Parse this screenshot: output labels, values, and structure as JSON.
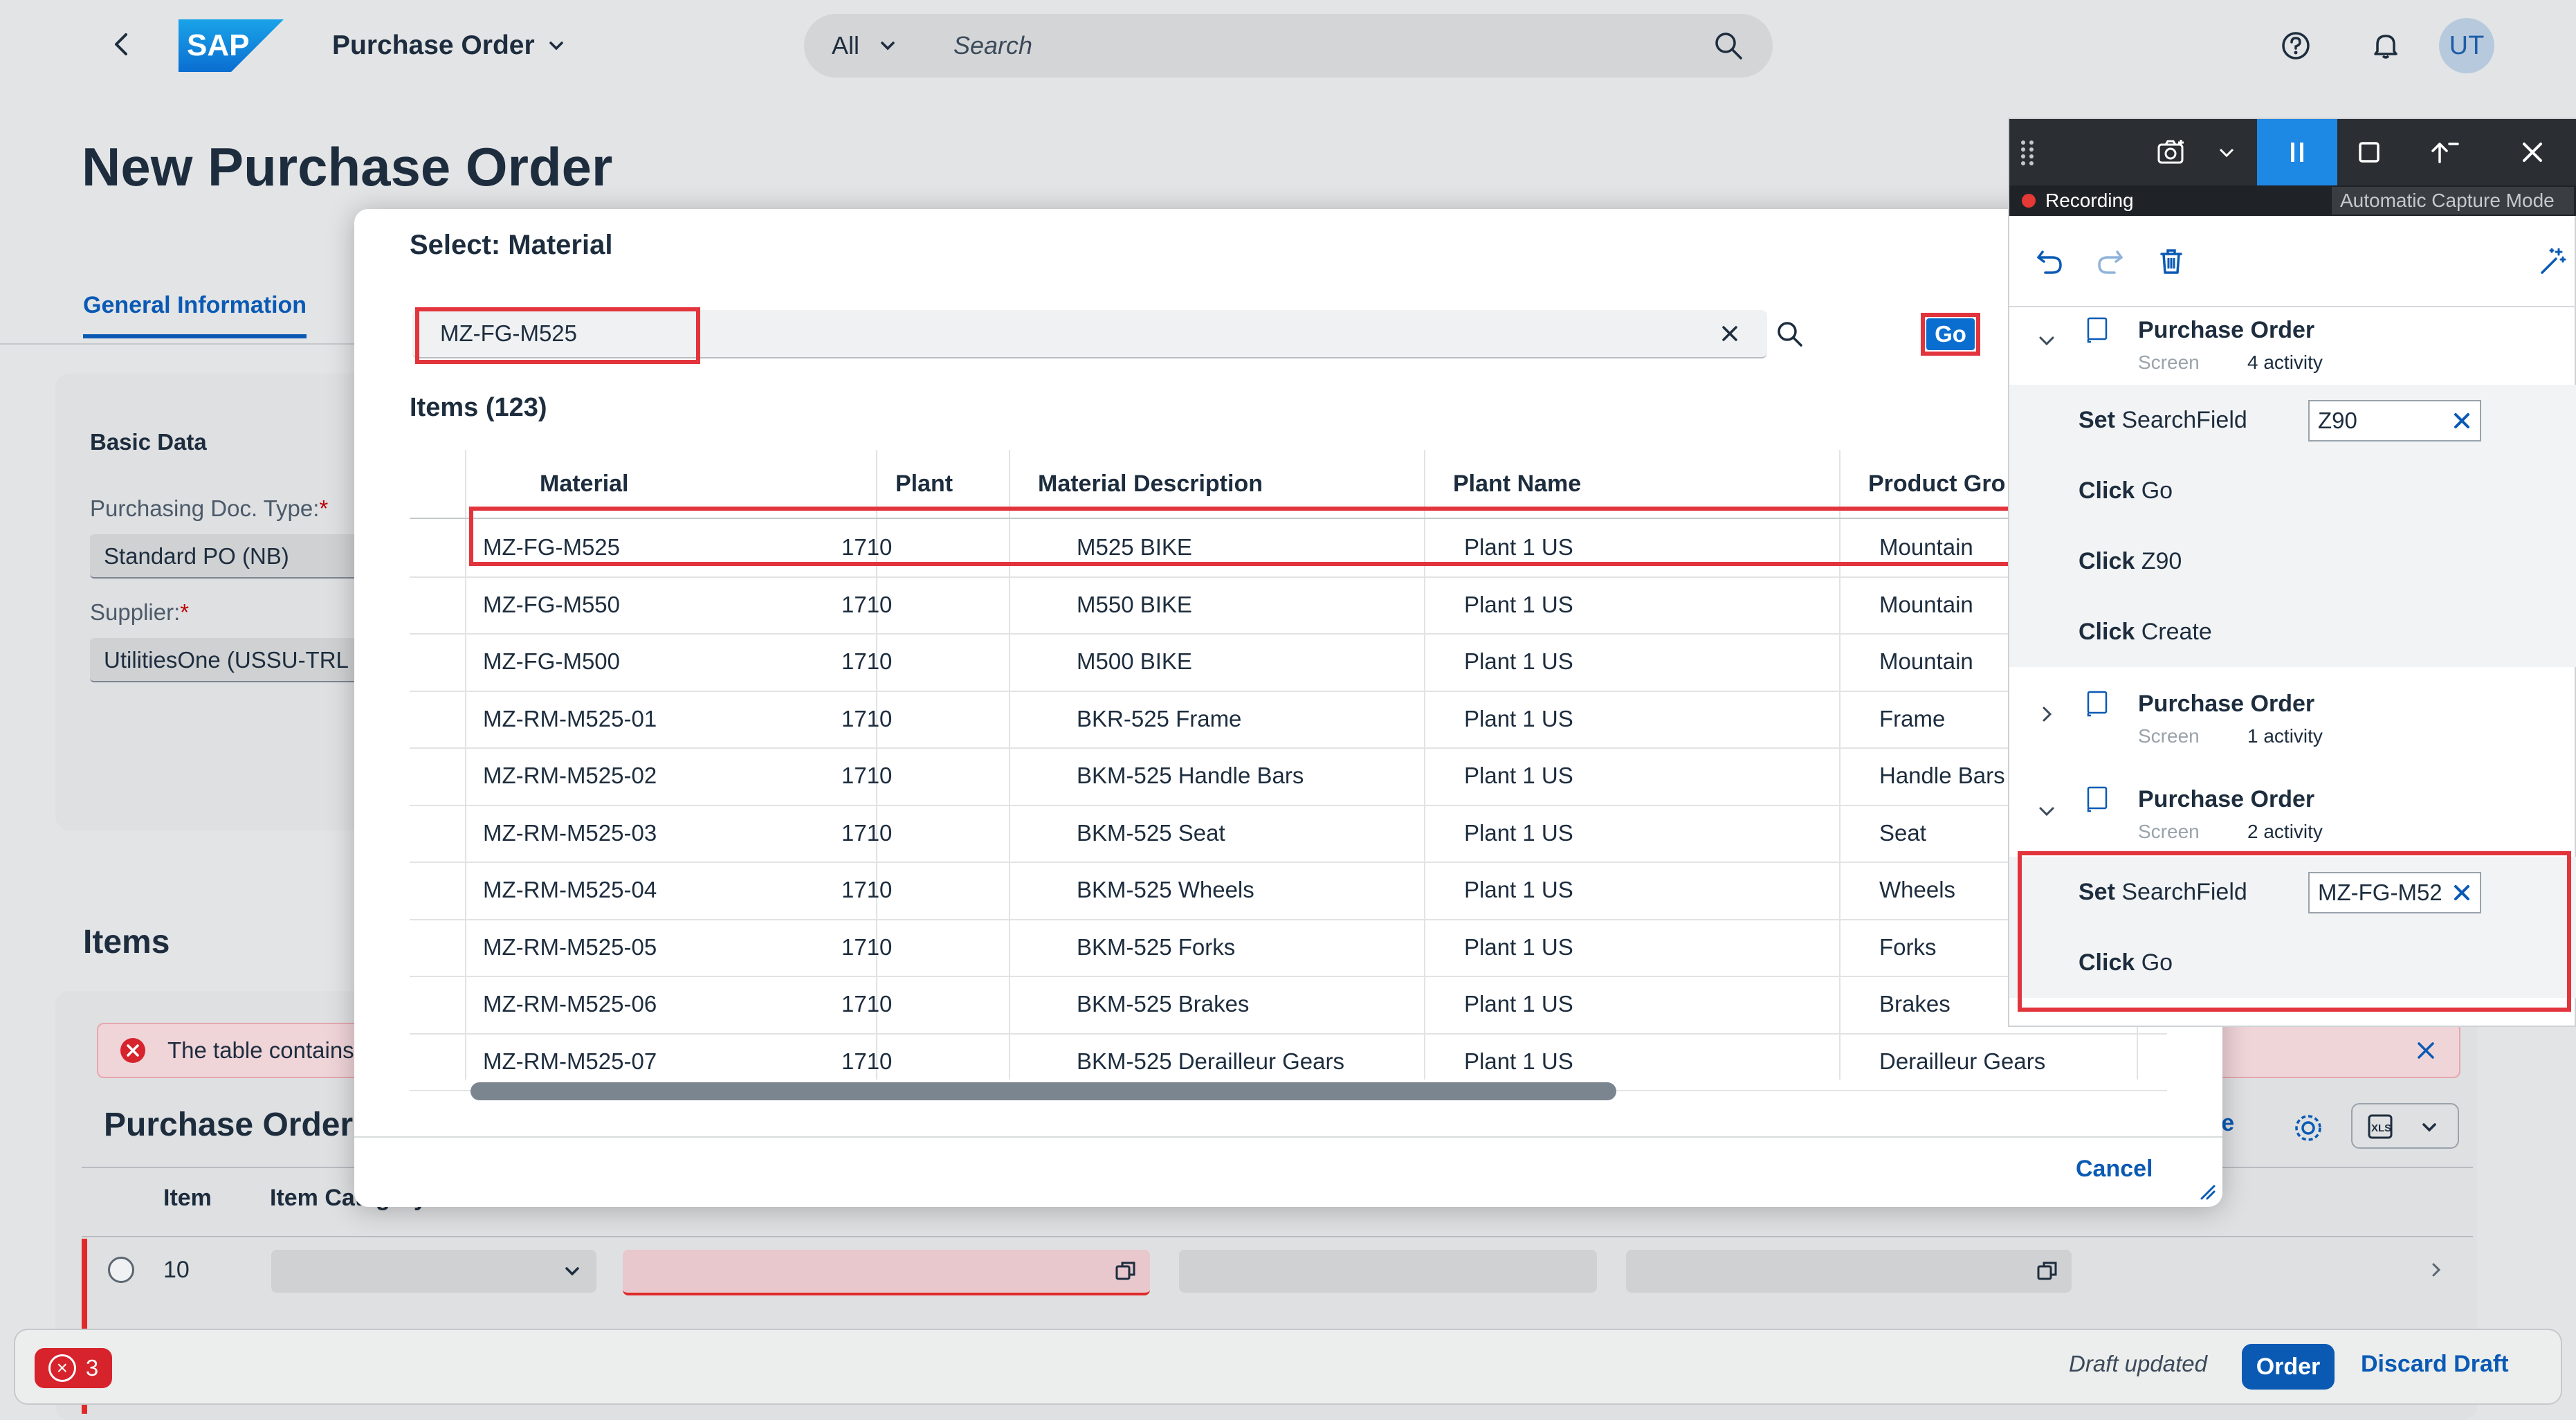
{
  "shell": {
    "title": "Purchase Order",
    "search_scope": "All",
    "search_placeholder": "Search",
    "avatar_initials": "UT",
    "logo_text": "SAP"
  },
  "page": {
    "title": "New Purchase Order",
    "tab": "General Information",
    "basic_data": "Basic Data",
    "doc_type_label": "Purchasing Doc. Type:",
    "doc_type_value": "Standard PO (NB)",
    "supplier_label": "Supplier:",
    "supplier_value": "UtilitiesOne (USSU-TRL",
    "required_mark": "*",
    "items_heading": "Items",
    "error_message": "The table contains",
    "po_heading": "Purchase Order",
    "col_item": "Item",
    "col_item_category": "Item Category",
    "row_item": "10",
    "partial_link": "ate"
  },
  "footer": {
    "error_count": "3",
    "draft_status": "Draft updated",
    "order_label": "Order",
    "discard_label": "Discard Draft"
  },
  "dialog": {
    "title": "Select: Material",
    "search_value": "MZ-FG-M525",
    "go_label": "Go",
    "items_count": "Items (123)",
    "cancel_label": "Cancel",
    "columns": [
      "Material",
      "Plant",
      "Material Description",
      "Plant Name",
      "Product Gro"
    ],
    "rows": [
      [
        "MZ-FG-M525",
        "1710",
        "M525 BIKE",
        "Plant 1 US",
        "Mountain"
      ],
      [
        "MZ-FG-M550",
        "1710",
        "M550 BIKE",
        "Plant 1 US",
        "Mountain"
      ],
      [
        "MZ-FG-M500",
        "1710",
        "M500 BIKE",
        "Plant 1 US",
        "Mountain"
      ],
      [
        "MZ-RM-M525-01",
        "1710",
        "BKR-525 Frame",
        "Plant 1 US",
        "Frame"
      ],
      [
        "MZ-RM-M525-02",
        "1710",
        "BKM-525 Handle Bars",
        "Plant 1 US",
        "Handle Bars"
      ],
      [
        "MZ-RM-M525-03",
        "1710",
        "BKM-525 Seat",
        "Plant 1 US",
        "Seat"
      ],
      [
        "MZ-RM-M525-04",
        "1710",
        "BKM-525 Wheels",
        "Plant 1 US",
        "Wheels"
      ],
      [
        "MZ-RM-M525-05",
        "1710",
        "BKM-525 Forks",
        "Plant 1 US",
        "Forks"
      ],
      [
        "MZ-RM-M525-06",
        "1710",
        "BKM-525 Brakes",
        "Plant 1 US",
        "Brakes"
      ],
      [
        "MZ-RM-M525-07",
        "1710",
        "BKM-525 Derailleur Gears",
        "Plant 1 US",
        "Derailleur Gears"
      ]
    ]
  },
  "recorder": {
    "status": "Recording",
    "mode": "Automatic Capture Mode",
    "groups": [
      {
        "title": "Purchase Order",
        "type": "Screen",
        "count": "4 activity"
      },
      {
        "title": "Purchase Order",
        "type": "Screen",
        "count": "1 activity"
      },
      {
        "title": "Purchase Order",
        "type": "Screen",
        "count": "2 activity"
      }
    ],
    "actions_group1": [
      {
        "verb": "Set",
        "target": "SearchField",
        "value": "Z90"
      },
      {
        "verb": "Click",
        "target": "Go"
      },
      {
        "verb": "Click",
        "target": "Z90"
      },
      {
        "verb": "Click",
        "target": "Create"
      }
    ],
    "actions_group3": [
      {
        "verb": "Set",
        "target": "SearchField",
        "value": "MZ-FG-M52"
      },
      {
        "verb": "Click",
        "target": "Go"
      }
    ]
  },
  "colors": {
    "accent": "#0a5ab4",
    "highlight": "#e2343c",
    "recorder_bar": "#2b2f33",
    "recording_dot": "#e53935"
  }
}
